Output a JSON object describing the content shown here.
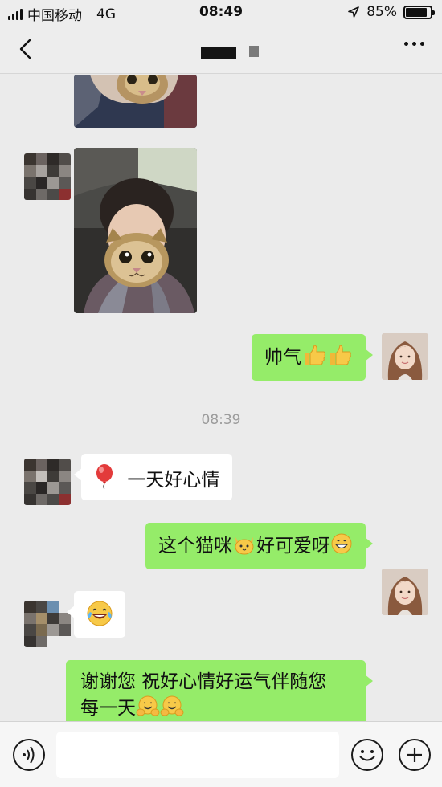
{
  "status_bar": {
    "carrier": "中国移动",
    "network": "4G",
    "time": "08:49",
    "battery": "85%",
    "battery_level": 0.85
  },
  "nav": {
    "back_icon": "chevron-left-icon",
    "more_icon": "more-dots-icon"
  },
  "chat": {
    "timestamp": "08:39",
    "messages": [
      {
        "from": "me",
        "text": "帅气",
        "emoji": [
          "thumbs-up",
          "thumbs-up"
        ]
      },
      {
        "from": "them",
        "text": "一天好心情",
        "emoji_before": "balloon"
      },
      {
        "from": "me",
        "text_before": "这个猫咪",
        "emoji_mid": "cat-face",
        "text_after": "好可爱呀",
        "emoji_end": "grinning-face"
      },
      {
        "from": "them",
        "emoji": "face-with-tears-of-joy"
      },
      {
        "from": "me",
        "line1": "谢谢您 祝好心情好运气伴随您",
        "line2": "每一天",
        "emoji": [
          "hugging-face",
          "hugging-face"
        ]
      }
    ]
  },
  "input_bar": {
    "voice_icon": "voice-icon",
    "emoji_icon": "smiley-icon",
    "plus_icon": "plus-icon"
  },
  "colors": {
    "my_bubble": "#95ec69",
    "their_bubble": "#ffffff",
    "background": "#ebebeb"
  }
}
